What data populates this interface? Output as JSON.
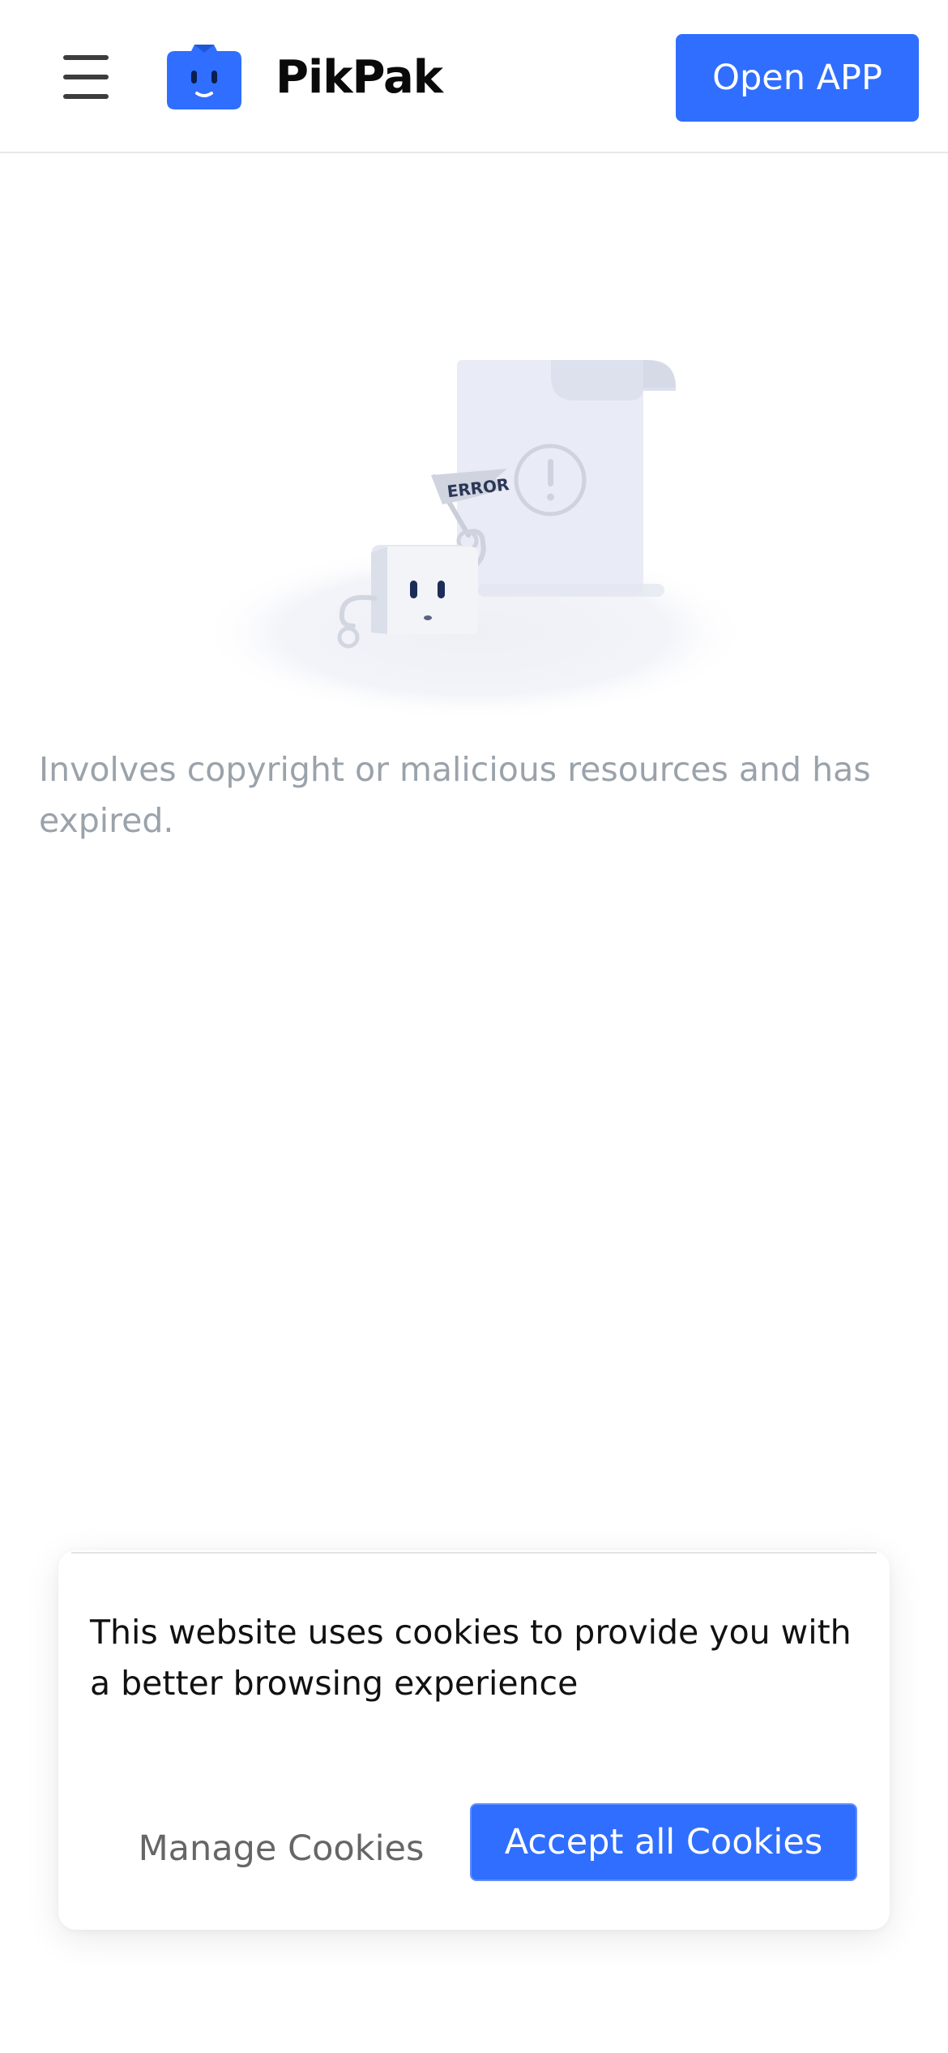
{
  "header": {
    "brand": "PikPak",
    "open_app_label": "Open APP"
  },
  "main": {
    "illustration_flag_text": "ERROR",
    "message": "Involves copyright or malicious resources and has expired."
  },
  "cookie_banner": {
    "text": "This website uses cookies to provide you with a better browsing experience",
    "manage_label": "Manage Cookies",
    "accept_label": "Accept all Cookies"
  },
  "colors": {
    "accent": "#306eff",
    "message_text": "#9aa2ab",
    "header_border": "#e8e8e8"
  },
  "icons": {
    "menu": "hamburger-menu-icon",
    "logo": "pikpak-box-face-logo"
  }
}
